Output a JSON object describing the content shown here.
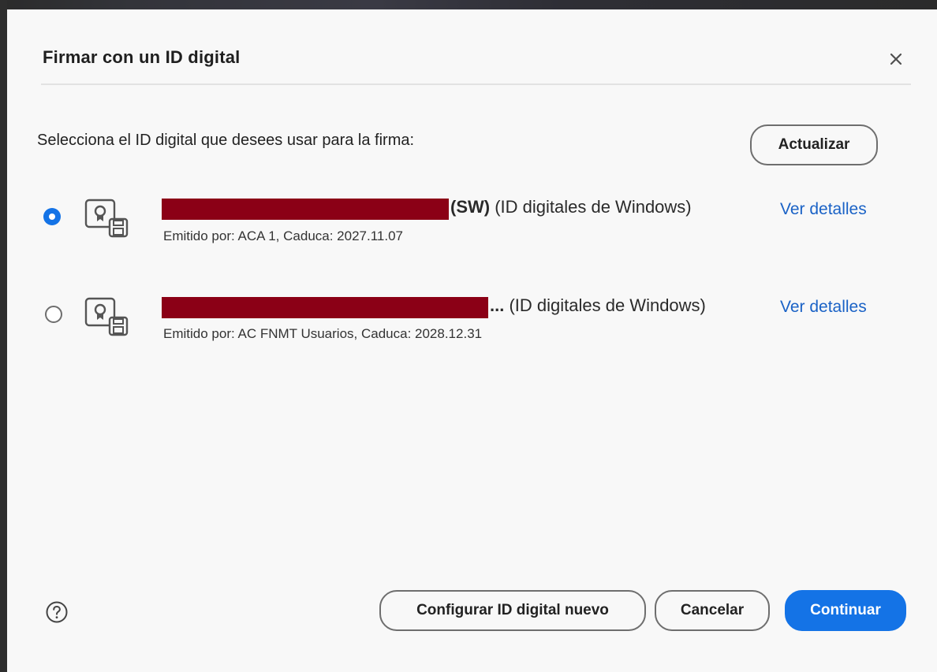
{
  "dialog": {
    "title": "Firmar con un ID digital",
    "close_icon": "close-icon",
    "prompt": "Selecciona el ID digital que desees usar para la firma:",
    "refresh_label": "Actualizar"
  },
  "ids": [
    {
      "selected": true,
      "name_suffix_bold": "(SW)",
      "name_suffix": " (ID digitales de Windows)",
      "meta": "Emitido por: ACA 1, Caduca: 2027.11.07",
      "details_label": "Ver detalles",
      "icon": "certificate-icon"
    },
    {
      "selected": false,
      "name_suffix_bold": "...",
      "name_suffix": " (ID digitales de Windows)",
      "meta": "Emitido por: AC FNMT Usuarios, Caduca: 2028.12.31",
      "details_label": "Ver detalles",
      "icon": "certificate-icon"
    }
  ],
  "footer": {
    "help_icon": "help-icon",
    "configure_label": "Configurar ID digital nuevo",
    "cancel_label": "Cancelar",
    "continue_label": "Continuar"
  },
  "colors": {
    "accent": "#1473e6",
    "redaction": "#8b0016",
    "link": "#1a62c6"
  }
}
